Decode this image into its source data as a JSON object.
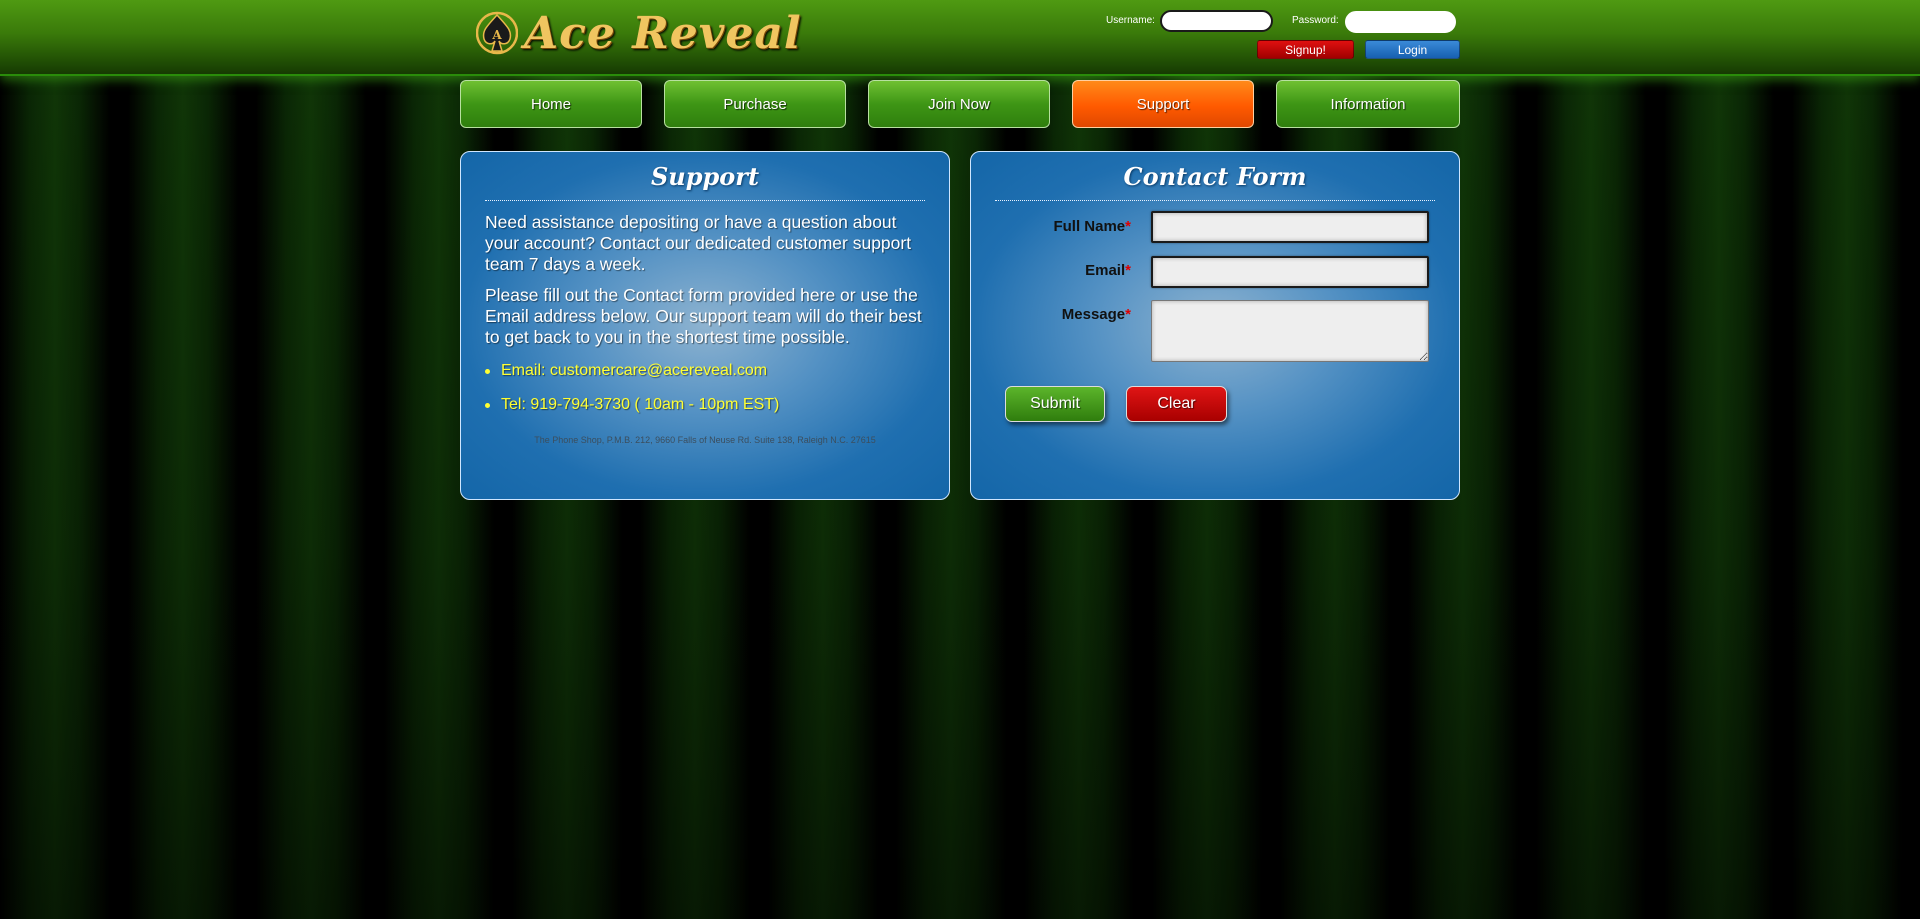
{
  "header": {
    "logo_text": "Ace Reveal",
    "username_label": "Username:",
    "password_label": "Password:",
    "signup_label": "Signup!",
    "login_label": "Login"
  },
  "nav": {
    "items": [
      {
        "label": "Home"
      },
      {
        "label": "Purchase"
      },
      {
        "label": "Join Now"
      },
      {
        "label": "Support"
      },
      {
        "label": "Information"
      }
    ],
    "active": "Support"
  },
  "support": {
    "title": "Support",
    "paragraph1": "Need assistance depositing or have a question about your account? Contact our dedicated customer support team 7 days a week.",
    "paragraph2": "Please fill out the Contact form provided here or use the Email address below. Our support team will do their best to get back to you in the shortest time possible.",
    "email": "Email: customercare@acereveal.com",
    "tel": "Tel: 919-794-3730 ( 10am - 10pm EST)",
    "address": "The Phone Shop, P.M.B. 212, 9660 Falls of Neuse Rd. Suite 138, Raleigh N.C. 27615"
  },
  "contact": {
    "title": "Contact Form",
    "full_name_label": "Full Name",
    "email_label": "Email",
    "message_label": "Message",
    "required_mark": "*",
    "submit_label": "Submit",
    "clear_label": "Clear"
  },
  "colors": {
    "header_green": "#3a7a0a",
    "nav_green": "#3e9615",
    "nav_active_orange": "#ff5a00",
    "panel_blue": "#1f6fb0",
    "link_yellow": "#ffff33",
    "required_red": "#e00000"
  }
}
